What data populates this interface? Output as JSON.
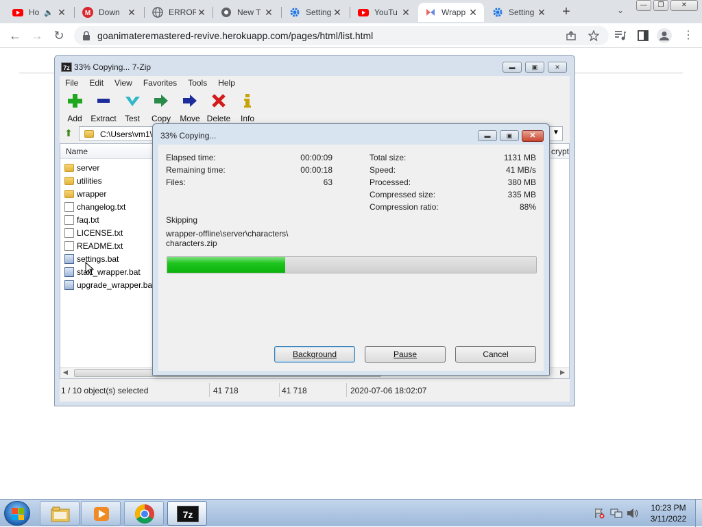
{
  "browser": {
    "tabs": [
      {
        "title": "Ho",
        "icon": "youtube-icon"
      },
      {
        "title": "Down",
        "icon": "mega-icon"
      },
      {
        "title": "ERROR",
        "icon": "globe-icon"
      },
      {
        "title": "New T",
        "icon": "chrome-icon"
      },
      {
        "title": "Setting",
        "icon": "gear-icon"
      },
      {
        "title": "YouTu",
        "icon": "youtube-icon"
      },
      {
        "title": "Wrapp",
        "icon": "wrapper-icon"
      },
      {
        "title": "Setting",
        "icon": "gear-icon"
      }
    ],
    "new_tab_symbol": "+",
    "url": "goanimateremastered-revive.herokuapp.com/pages/html/list.html"
  },
  "zip_window": {
    "title": "33% Copying... 7-Zip",
    "menu": [
      "File",
      "Edit",
      "View",
      "Favorites",
      "Tools",
      "Help"
    ],
    "toolbar": [
      {
        "label": "Add",
        "icon": "plus-icon",
        "color": "#1fa81f"
      },
      {
        "label": "Extract",
        "icon": "minus-icon",
        "color": "#1d2c9c"
      },
      {
        "label": "Test",
        "icon": "check-icon",
        "color": "#2fb8c8"
      },
      {
        "label": "Copy",
        "icon": "copy-arrow-icon",
        "color": "#2a8a4a"
      },
      {
        "label": "Move",
        "icon": "move-arrow-icon",
        "color": "#1d2c9c"
      },
      {
        "label": "Delete",
        "icon": "delete-x-icon",
        "color": "#d41a1a"
      },
      {
        "label": "Info",
        "icon": "info-icon",
        "color": "#c9a20a"
      }
    ],
    "path": "C:\\Users\\vm1\\",
    "column_name": "Name",
    "column_crypt": "crypt",
    "files": [
      {
        "name": "server",
        "type": "folder"
      },
      {
        "name": "utilities",
        "type": "folder"
      },
      {
        "name": "wrapper",
        "type": "folder"
      },
      {
        "name": "changelog.txt",
        "type": "txt"
      },
      {
        "name": "faq.txt",
        "type": "txt"
      },
      {
        "name": "LICENSE.txt",
        "type": "txt"
      },
      {
        "name": "README.txt",
        "type": "txt"
      },
      {
        "name": "settings.bat",
        "type": "bat"
      },
      {
        "name": "start_wrapper.bat",
        "type": "bat"
      },
      {
        "name": "upgrade_wrapper.bat",
        "type": "bat"
      }
    ],
    "status": {
      "selection": "1 / 10 object(s) selected",
      "size": "41 718",
      "packed": "41 718",
      "modified": "2020-07-06 18:02:07"
    }
  },
  "dialog": {
    "title": "33% Copying...",
    "left_labels": [
      "Elapsed time:",
      "Remaining time:",
      "Files:"
    ],
    "left_values": [
      "00:00:09",
      "00:00:18",
      "63"
    ],
    "right_labels": [
      "Total size:",
      "Speed:",
      "Processed:",
      "Compressed size:",
      "Compression ratio:"
    ],
    "right_values": [
      "1131 MB",
      "41 MB/s",
      "380 MB",
      "335 MB",
      "88%"
    ],
    "operation": "Skipping",
    "current_file_line1": "wrapper-offline\\server\\characters\\",
    "current_file_line2": "characters.zip",
    "progress_fraction": 0.32,
    "buttons": {
      "background": "Background",
      "pause": "Pause",
      "cancel": "Cancel"
    }
  },
  "taskbar": {
    "time": "10:23 PM",
    "date": "3/11/2022"
  }
}
